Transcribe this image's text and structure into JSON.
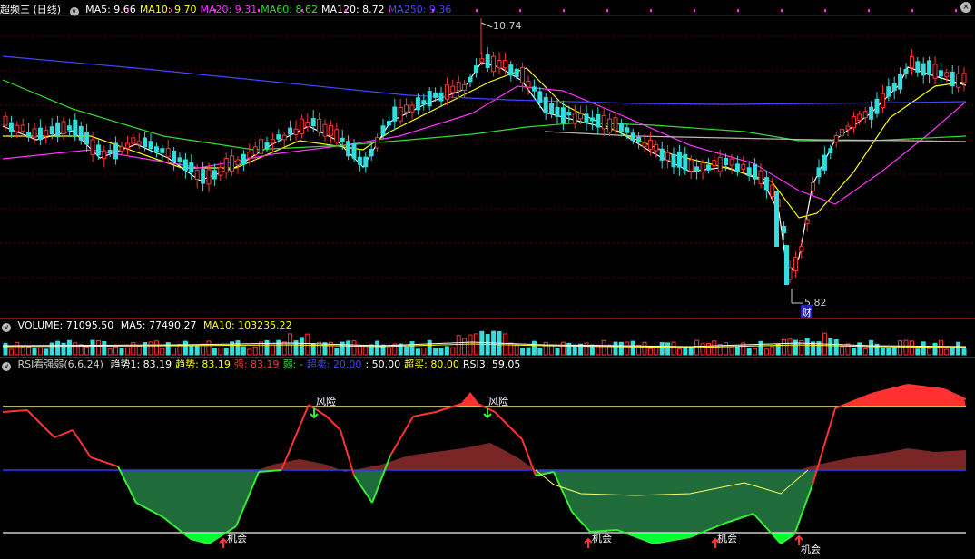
{
  "main": {
    "title": "超频三 (日线)",
    "ma": [
      {
        "label": "MA5: 9.66",
        "color": "#ffffff"
      },
      {
        "label": "MA10: 9.70",
        "color": "#ffff00"
      },
      {
        "label": "MA20: 9.31",
        "color": "#ff33ff"
      },
      {
        "label": "MA60: 8.62",
        "color": "#33dd33"
      },
      {
        "label": "MA120: 8.72",
        "color": "#ffffff"
      },
      {
        "label": "MA250: 9.36",
        "color": "#4444ff"
      }
    ],
    "high_label": "10.74",
    "low_label": "5.82",
    "cai_label": "财",
    "close_glyph": "×"
  },
  "volume": {
    "label": "VOLUME: 71095.50",
    "ma5": "MA5: 77490.27",
    "ma10": "MA10: 103235.22"
  },
  "rsi": {
    "title": "RSI看强弱(6,6,24)",
    "items": [
      {
        "label": "趋势1: 83.19",
        "color": "#ffffff"
      },
      {
        "label": "趋势: 83.19",
        "color": "#ffff00"
      },
      {
        "label": "强: 83.19",
        "color": "#ff3333"
      },
      {
        "label": "弱: -",
        "color": "#33dd33"
      },
      {
        "label": "超卖: 20.00",
        "color": "#4444ff"
      },
      {
        "label": ": 50.00",
        "color": "#ffffff"
      },
      {
        "label": "超买: 80.00",
        "color": "#ffff00"
      },
      {
        "label": "RSI3: 59.05",
        "color": "#ffffff"
      }
    ],
    "risk_label": "风险",
    "chance_label": "机会"
  },
  "colors": {
    "up": "#ff3333",
    "down": "#33dddd",
    "ma5": "#ffffff",
    "ma10": "#ffff00",
    "ma20": "#ff33ff",
    "ma60": "#33dd33",
    "ma250": "#4444ff",
    "grid": "#5a0000"
  },
  "icons": [
    "collapse-icon",
    "close-icon",
    "arrow-up-icon",
    "arrow-down-icon"
  ]
}
